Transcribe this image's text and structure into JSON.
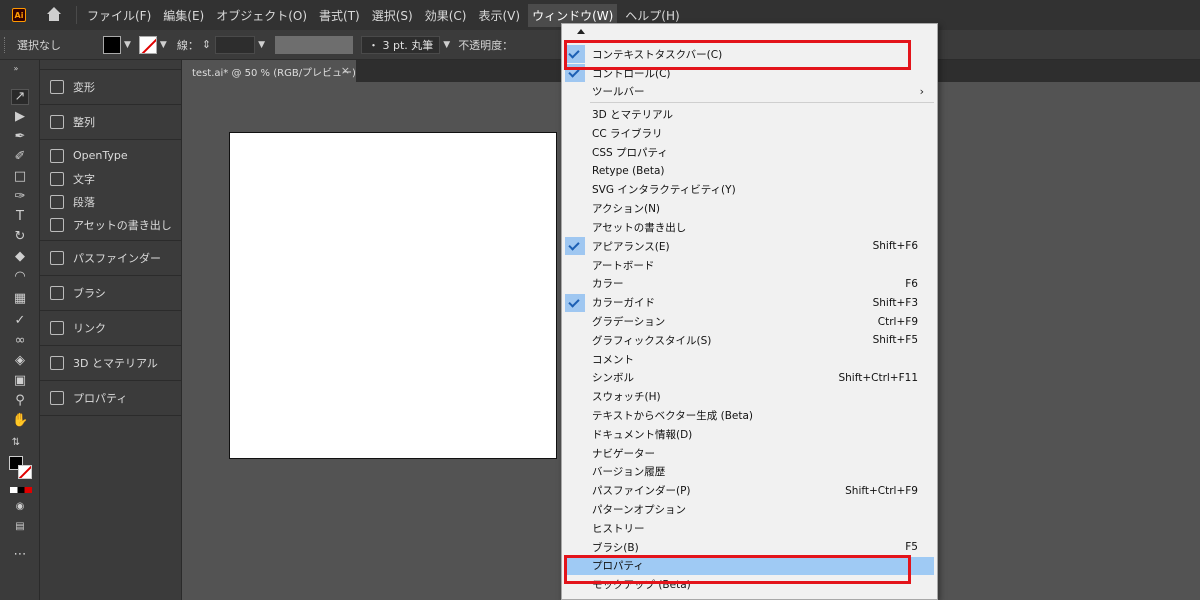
{
  "app": {
    "logo": "Ai"
  },
  "menubar": {
    "items": [
      "ファイル(F)",
      "編集(E)",
      "オブジェクト(O)",
      "書式(T)",
      "選択(S)",
      "効果(C)",
      "表示(V)",
      "ウィンドウ(W)",
      "ヘルプ(H)"
    ],
    "active_index": 7
  },
  "control": {
    "selection_label": "選択なし",
    "stroke_label": "線：",
    "brush_label": "・ 3 pt. 丸筆",
    "opacity_label": "不透明度："
  },
  "panels": {
    "groups": [
      [
        {
          "label": "変形",
          "icon": "transform-icon"
        }
      ],
      [
        {
          "label": "整列",
          "icon": "align-icon"
        }
      ],
      [
        {
          "label": "OpenType",
          "icon": "opentype-icon"
        },
        {
          "label": "文字",
          "icon": "character-icon"
        },
        {
          "label": "段落",
          "icon": "paragraph-icon"
        },
        {
          "label": "アセットの書き出し",
          "icon": "asset-export-icon"
        }
      ],
      [
        {
          "label": "パスファインダー",
          "icon": "pathfinder-icon"
        }
      ],
      [
        {
          "label": "ブラシ",
          "icon": "brush-icon"
        }
      ],
      [
        {
          "label": "リンク",
          "icon": "link-icon"
        }
      ],
      [
        {
          "label": "3D とマテリアル",
          "icon": "3d-materials-icon"
        }
      ],
      [
        {
          "label": "プロパティ",
          "icon": "properties-icon"
        }
      ]
    ]
  },
  "document": {
    "tab_title": "test.ai* @ 50 % (RGB/プレビュー)",
    "close_glyph": "×"
  },
  "window_menu": {
    "items": [
      {
        "label": "コンテキストタスクバー(C)",
        "checked": true
      },
      {
        "label": "コントロール(C)",
        "checked": true
      },
      {
        "label": "ツールバー",
        "submenu": true
      },
      {
        "divider": true
      },
      {
        "label": "3D とマテリアル"
      },
      {
        "label": "CC ライブラリ"
      },
      {
        "label": "CSS プロパティ"
      },
      {
        "label": "Retype (Beta)"
      },
      {
        "label": "SVG インタラクティビティ(Y)"
      },
      {
        "label": "アクション(N)"
      },
      {
        "label": "アセットの書き出し"
      },
      {
        "label": "アピアランス(E)",
        "checked": true,
        "shortcut": "Shift+F6"
      },
      {
        "label": "アートボード"
      },
      {
        "label": "カラー",
        "shortcut": "F6"
      },
      {
        "label": "カラーガイド",
        "checked": true,
        "shortcut": "Shift+F3"
      },
      {
        "label": "グラデーション",
        "shortcut": "Ctrl+F9"
      },
      {
        "label": "グラフィックスタイル(S)",
        "shortcut": "Shift+F5"
      },
      {
        "label": "コメント"
      },
      {
        "label": "シンボル",
        "shortcut": "Shift+Ctrl+F11"
      },
      {
        "label": "スウォッチ(H)"
      },
      {
        "label": "テキストからベクター生成 (Beta)"
      },
      {
        "label": "ドキュメント情報(D)"
      },
      {
        "label": "ナビゲーター"
      },
      {
        "label": "バージョン履歴"
      },
      {
        "label": "パスファインダー(P)",
        "shortcut": "Shift+Ctrl+F9"
      },
      {
        "label": "パターンオプション"
      },
      {
        "label": "ヒストリー"
      },
      {
        "label": "ブラシ(B)",
        "shortcut": "F5"
      },
      {
        "label": "プロパティ",
        "highlighted": true
      },
      {
        "label": "モックアップ (Beta)"
      }
    ]
  },
  "colors": {
    "highlight": "#9fcaf4",
    "check": "#1c5fb4",
    "annotation": "#e3141b"
  }
}
